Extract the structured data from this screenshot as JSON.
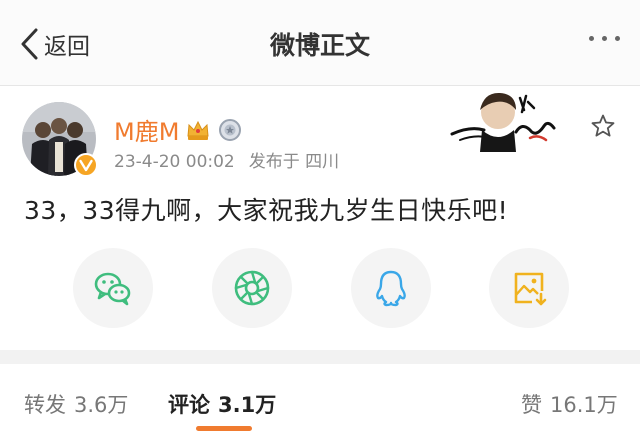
{
  "nav": {
    "back_label": "返回",
    "title": "微博正文"
  },
  "post": {
    "username": "M鹿M",
    "date": "23-4-20 00:02",
    "location": "发布于 四川",
    "text": "33，33得九啊，大家祝我九岁生日快乐吧!"
  },
  "share_icons": [
    "wechat-icon",
    "moments-icon",
    "qq-icon",
    "save-image-icon"
  ],
  "tabs": {
    "repost": {
      "label": "转发",
      "count": "3.6万"
    },
    "comment": {
      "label": "评论",
      "count": "3.1万"
    },
    "like": {
      "label": "赞",
      "count": "16.1万"
    }
  },
  "colors": {
    "accent": "#f07b2f",
    "wechat": "#3fbd7e",
    "moments": "#3fbd7e",
    "qq": "#3aa7e8",
    "save": "#f0b21e"
  }
}
